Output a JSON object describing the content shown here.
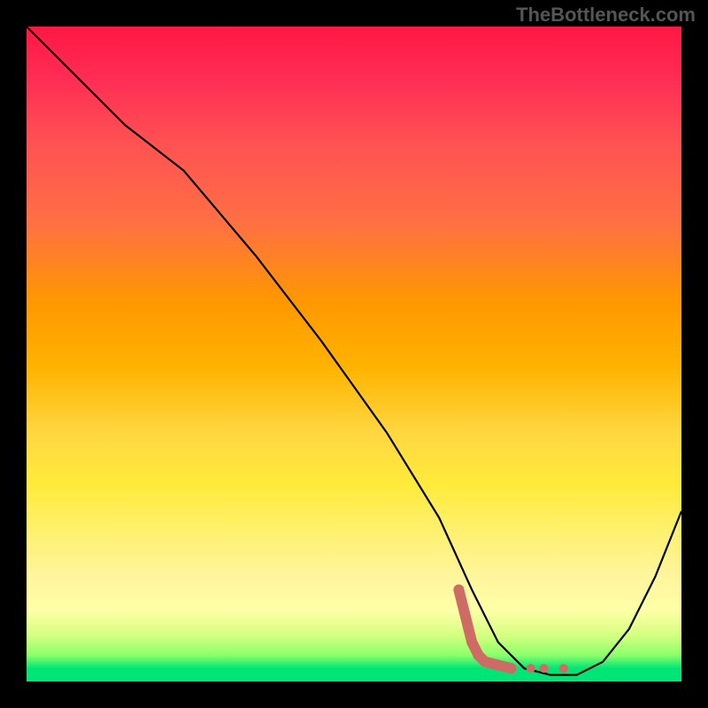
{
  "attribution": "TheBottleneck.com",
  "chart_data": {
    "type": "line",
    "title": "",
    "xlabel": "",
    "ylabel": "",
    "xlim": [
      0,
      100
    ],
    "ylim": [
      0,
      100
    ],
    "series": [
      {
        "name": "bottleneck-curve",
        "color": "#000000",
        "x": [
          0,
          8,
          15,
          24,
          35,
          45,
          55,
          63,
          68,
          72,
          76,
          80,
          84,
          88,
          92,
          96,
          100
        ],
        "y": [
          100,
          92,
          85,
          78,
          65,
          52,
          38,
          25,
          14,
          6,
          2,
          1,
          1,
          3,
          8,
          16,
          26
        ]
      }
    ],
    "marker_series": {
      "name": "optimal-zone-markers",
      "color": "#cf6b65",
      "points": [
        {
          "x": 66,
          "y": 14
        },
        {
          "x": 67,
          "y": 10
        },
        {
          "x": 68,
          "y": 6
        },
        {
          "x": 69,
          "y": 4
        },
        {
          "x": 70,
          "y": 3
        },
        {
          "x": 72,
          "y": 2.5
        },
        {
          "x": 74,
          "y": 2
        },
        {
          "x": 77,
          "y": 2
        },
        {
          "x": 79,
          "y": 2
        },
        {
          "x": 82,
          "y": 2
        }
      ]
    },
    "gradient_stops": [
      {
        "pos": 0.0,
        "color": "#ff1744"
      },
      {
        "pos": 0.5,
        "color": "#ffc107"
      },
      {
        "pos": 0.8,
        "color": "#ffee58"
      },
      {
        "pos": 0.98,
        "color": "#00e676"
      }
    ]
  }
}
